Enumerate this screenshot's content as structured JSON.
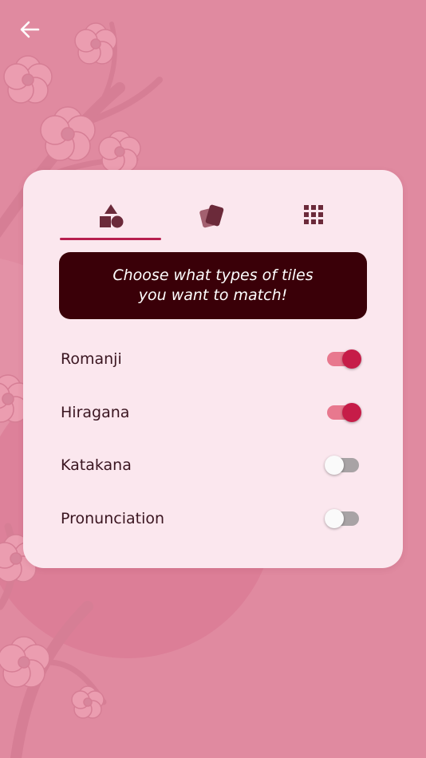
{
  "colors": {
    "background": "#e08aa0",
    "card": "#fbe7ee",
    "accent": "#b71f4f",
    "banner_bg": "#3a0008",
    "switch_on": "#c61c48"
  },
  "header": {
    "back_icon": "arrow-left-icon"
  },
  "tabs": [
    {
      "icon": "shapes-icon",
      "selected": true
    },
    {
      "icon": "cards-icon",
      "selected": false
    },
    {
      "icon": "grid-icon",
      "selected": false
    }
  ],
  "banner": {
    "line1": "Choose what types of tiles",
    "line2": "you want to match!"
  },
  "options": [
    {
      "label": "Romanji",
      "enabled": true
    },
    {
      "label": "Hiragana",
      "enabled": true
    },
    {
      "label": "Katakana",
      "enabled": false
    },
    {
      "label": "Pronunciation",
      "enabled": false
    }
  ]
}
